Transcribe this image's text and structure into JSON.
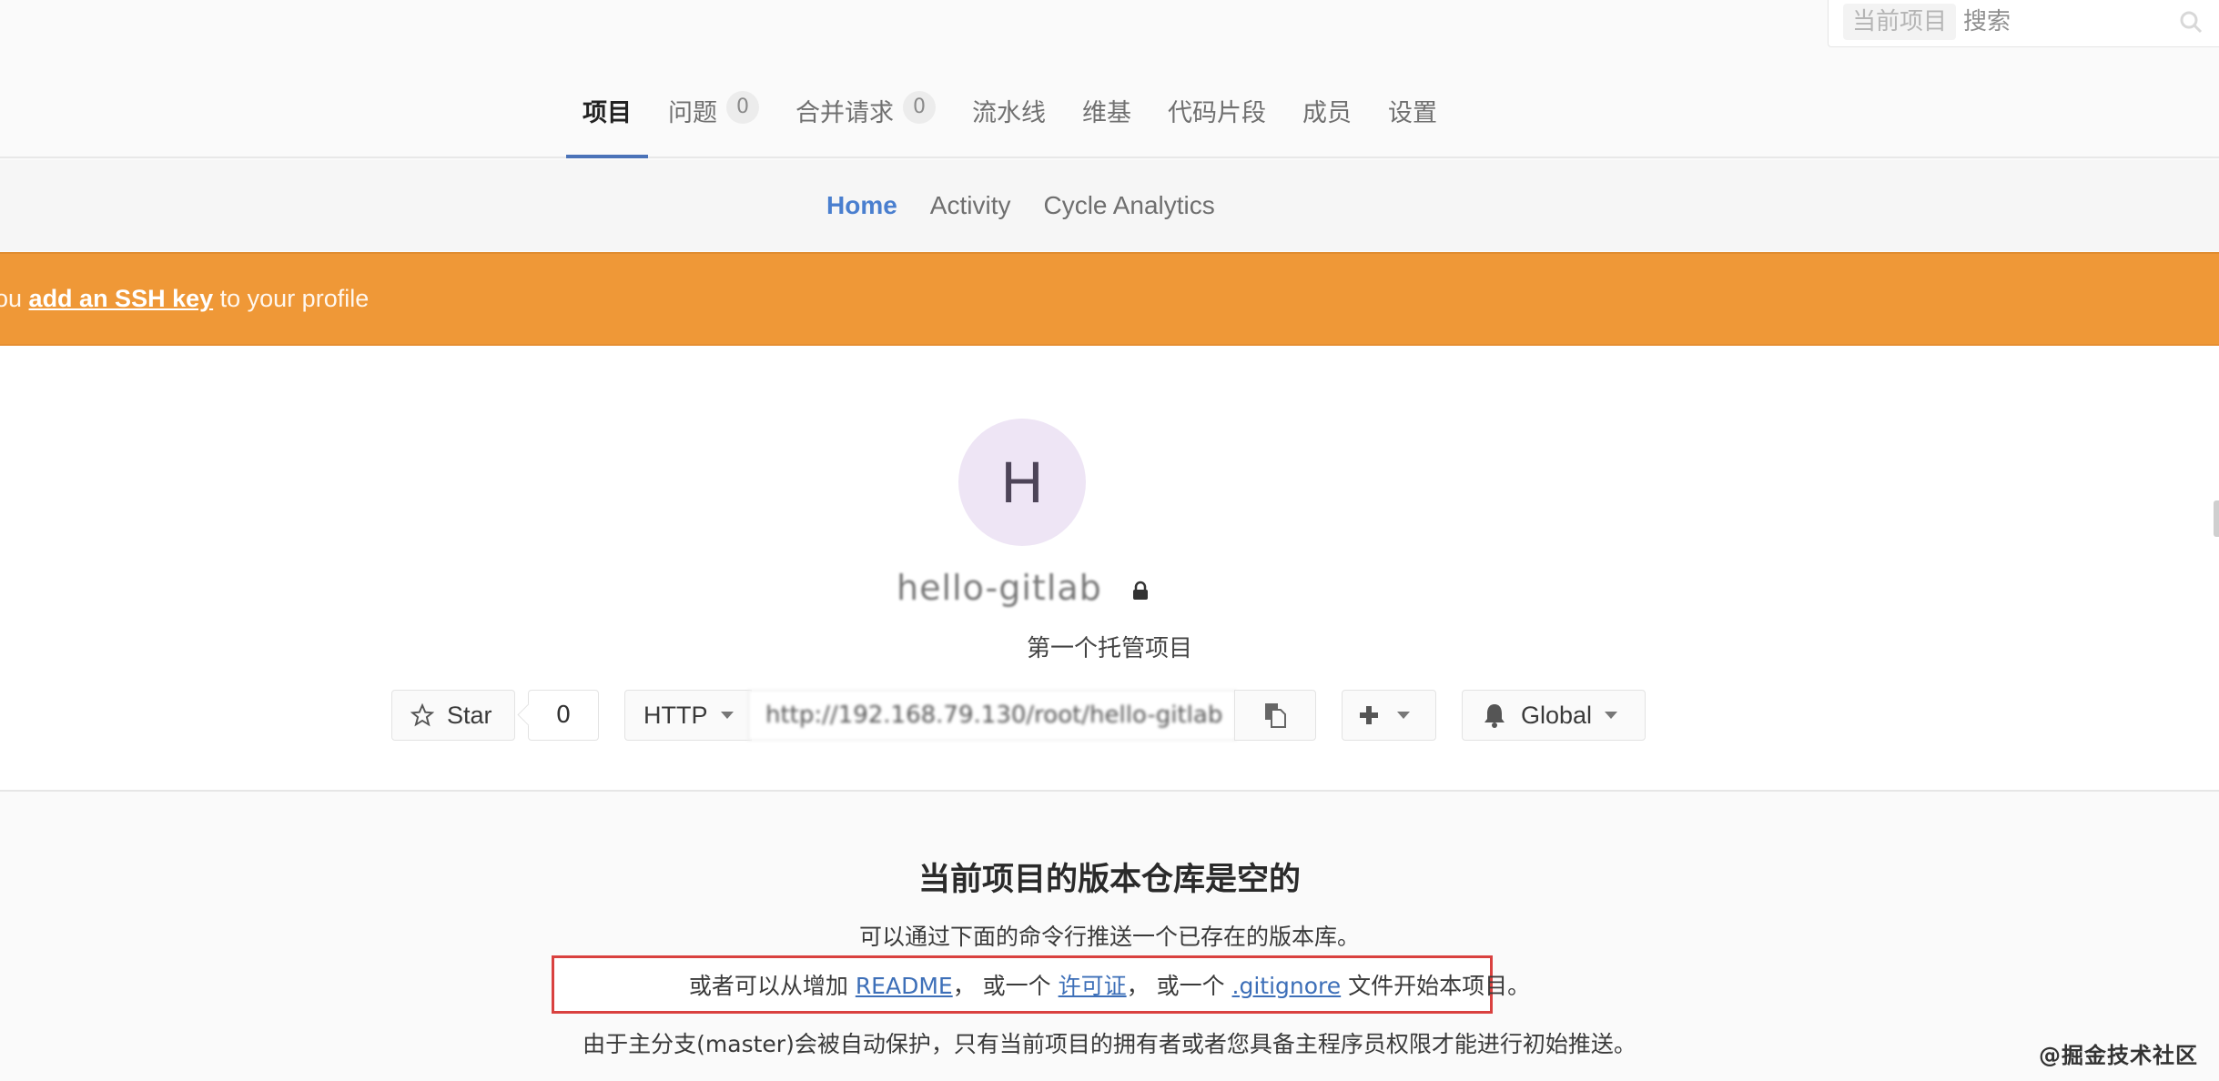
{
  "search": {
    "scope_label": "当前项目",
    "placeholder": "搜索",
    "icon": "search-icon"
  },
  "nav": {
    "items": [
      {
        "label": "项目",
        "active": true
      },
      {
        "label": "问题",
        "badge": "0"
      },
      {
        "label": "合并请求",
        "badge": "0"
      },
      {
        "label": "流水线"
      },
      {
        "label": "维基"
      },
      {
        "label": "代码片段"
      },
      {
        "label": "成员"
      },
      {
        "label": "设置"
      }
    ]
  },
  "subnav": {
    "items": [
      {
        "label": "Home",
        "active": true
      },
      {
        "label": "Activity"
      },
      {
        "label": "Cycle Analytics"
      }
    ]
  },
  "banner": {
    "prefix": "ou ",
    "link": "add an SSH key",
    "suffix": " to your profile",
    "color": "#ef9837"
  },
  "project": {
    "avatar_letter": "H",
    "name": "hello-gitlab",
    "visibility_icon": "lock-icon",
    "description": "第一个托管项目"
  },
  "actions": {
    "star_label": "Star",
    "star_count": "0",
    "protocol": "HTTP",
    "clone_url": "http://192.168.79.130/root/hello-gitlab",
    "add_label": "+",
    "notification_label": "Global"
  },
  "empty_state": {
    "title": "当前项目的版本仓库是空的",
    "line1": "可以通过下面的命令行推送一个已存在的版本库。",
    "line2": {
      "t1": "或者可以从增加 ",
      "readme": "README",
      "t2": "， 或一个 ",
      "license": "许可证",
      "t3": "， 或一个 ",
      "gitignore": ".gitignore",
      "t4": " 文件开始本项目。"
    },
    "line3": "由于主分支(master)会被自动保护，只有当前项目的拥有者或者您具备主程序员权限才能进行初始推送。",
    "highlight_color": "#d9413f"
  },
  "watermark": "@掘金技术社区",
  "colors": {
    "accent": "#4a7fcf",
    "nav_underline": "#4b73b8",
    "link": "#3d6fb8"
  }
}
